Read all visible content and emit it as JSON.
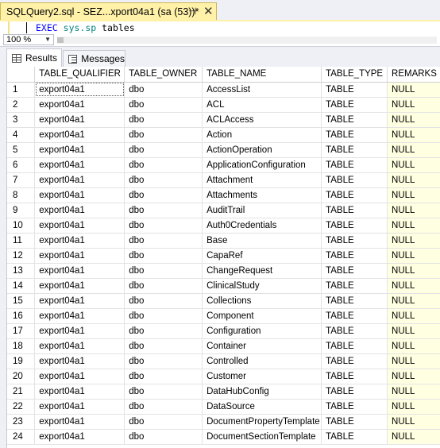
{
  "tab": {
    "title": "SQLQuery2.sql - SEZ...xport04a1 (sa (53))*",
    "pin_glyph": "⊣",
    "close_glyph": "✕"
  },
  "editor": {
    "keyword": "EXEC",
    "object": "sys.sp",
    "rest": " tables"
  },
  "zoom": {
    "value": "100 %"
  },
  "result_tabs": [
    {
      "label": "Results",
      "icon": "grid-icon"
    },
    {
      "label": "Messages",
      "icon": "messages-icon"
    }
  ],
  "grid": {
    "columns": [
      "",
      "TABLE_QUALIFIER",
      "TABLE_OWNER",
      "TABLE_NAME",
      "TABLE_TYPE",
      "REMARKS"
    ],
    "rows": [
      [
        "1",
        "export04a1",
        "dbo",
        "AccessList",
        "TABLE",
        "NULL"
      ],
      [
        "2",
        "export04a1",
        "dbo",
        "ACL",
        "TABLE",
        "NULL"
      ],
      [
        "3",
        "export04a1",
        "dbo",
        "ACLAccess",
        "TABLE",
        "NULL"
      ],
      [
        "4",
        "export04a1",
        "dbo",
        "Action",
        "TABLE",
        "NULL"
      ],
      [
        "5",
        "export04a1",
        "dbo",
        "ActionOperation",
        "TABLE",
        "NULL"
      ],
      [
        "6",
        "export04a1",
        "dbo",
        "ApplicationConfiguration",
        "TABLE",
        "NULL"
      ],
      [
        "7",
        "export04a1",
        "dbo",
        "Attachment",
        "TABLE",
        "NULL"
      ],
      [
        "8",
        "export04a1",
        "dbo",
        "Attachments",
        "TABLE",
        "NULL"
      ],
      [
        "9",
        "export04a1",
        "dbo",
        "AuditTrail",
        "TABLE",
        "NULL"
      ],
      [
        "10",
        "export04a1",
        "dbo",
        "Auth0Credentials",
        "TABLE",
        "NULL"
      ],
      [
        "11",
        "export04a1",
        "dbo",
        "Base",
        "TABLE",
        "NULL"
      ],
      [
        "12",
        "export04a1",
        "dbo",
        "CapaRef",
        "TABLE",
        "NULL"
      ],
      [
        "13",
        "export04a1",
        "dbo",
        "ChangeRequest",
        "TABLE",
        "NULL"
      ],
      [
        "14",
        "export04a1",
        "dbo",
        "ClinicalStudy",
        "TABLE",
        "NULL"
      ],
      [
        "15",
        "export04a1",
        "dbo",
        "Collections",
        "TABLE",
        "NULL"
      ],
      [
        "16",
        "export04a1",
        "dbo",
        "Component",
        "TABLE",
        "NULL"
      ],
      [
        "17",
        "export04a1",
        "dbo",
        "Configuration",
        "TABLE",
        "NULL"
      ],
      [
        "18",
        "export04a1",
        "dbo",
        "Container",
        "TABLE",
        "NULL"
      ],
      [
        "19",
        "export04a1",
        "dbo",
        "Controlled",
        "TABLE",
        "NULL"
      ],
      [
        "20",
        "export04a1",
        "dbo",
        "Customer",
        "TABLE",
        "NULL"
      ],
      [
        "21",
        "export04a1",
        "dbo",
        "DataHubConfig",
        "TABLE",
        "NULL"
      ],
      [
        "22",
        "export04a1",
        "dbo",
        "DataSource",
        "TABLE",
        "NULL"
      ],
      [
        "23",
        "export04a1",
        "dbo",
        "DocumentPropertyTemplate",
        "TABLE",
        "NULL"
      ],
      [
        "24",
        "export04a1",
        "dbo",
        "DocumentSectionTemplate",
        "TABLE",
        "NULL"
      ]
    ]
  }
}
